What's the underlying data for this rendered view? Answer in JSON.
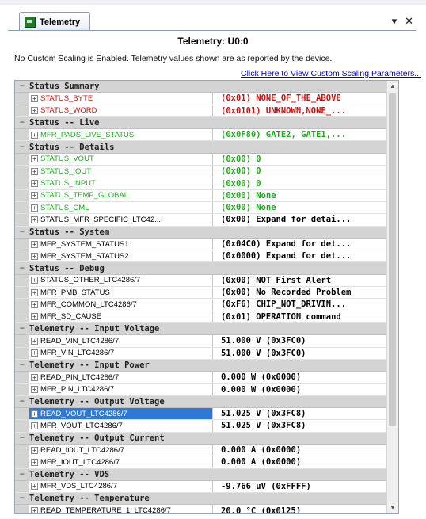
{
  "tab": {
    "label": "Telemetry"
  },
  "controls": {
    "dropdown": "▾",
    "close": "✕"
  },
  "title": "Telemetry: U0:0",
  "info": "No Custom Scaling is Enabled.  Telemetry values shown are as reported by the device.",
  "scaling_link": "Click Here to View Custom Scaling Parameters...",
  "colors": {
    "red": "#cc1111",
    "green": "#22a822",
    "black": "#000000",
    "selection": "#2f78d6"
  },
  "grid_rows": [
    {
      "type": "cat",
      "label": "Status Summary"
    },
    {
      "type": "prop",
      "name": "STATUS_BYTE",
      "value": "(0x01) NONE_OF_THE_ABOVE",
      "color": "red"
    },
    {
      "type": "prop",
      "name": "STATUS_WORD",
      "value": "(0x0101)  UNKNOWN,NONE_...",
      "color": "red"
    },
    {
      "type": "cat",
      "label": "Status -- Live"
    },
    {
      "type": "prop",
      "name": "MFR_PADS_LIVE_STATUS",
      "value": "(0x0F80)  GATE2, GATE1,...",
      "color": "green"
    },
    {
      "type": "cat",
      "label": "Status -- Details"
    },
    {
      "type": "prop",
      "name": "STATUS_VOUT",
      "value": "(0x00) 0",
      "color": "green"
    },
    {
      "type": "prop",
      "name": "STATUS_IOUT",
      "value": "(0x00) 0",
      "color": "green"
    },
    {
      "type": "prop",
      "name": "STATUS_INPUT",
      "value": "(0x00) 0",
      "color": "green"
    },
    {
      "type": "prop",
      "name": "STATUS_TEMP_GLOBAL",
      "value": "(0x00) None",
      "color": "green"
    },
    {
      "type": "prop",
      "name": "STATUS_CML",
      "value": "(0x00) None",
      "color": "green"
    },
    {
      "type": "prop",
      "name": "STATUS_MFR_SPECIFIC_LTC42...",
      "value": "(0x00) Expand for detai...",
      "color": "black"
    },
    {
      "type": "cat",
      "label": "Status -- System"
    },
    {
      "type": "prop",
      "name": "MFR_SYSTEM_STATUS1",
      "value": "(0x04C0) Expand for det...",
      "color": "black"
    },
    {
      "type": "prop",
      "name": "MFR_SYSTEM_STATUS2",
      "value": "(0x0000) Expand for det...",
      "color": "black"
    },
    {
      "type": "cat",
      "label": "Status -- Debug"
    },
    {
      "type": "prop",
      "name": "STATUS_OTHER_LTC4286/7",
      "value": "(0x00) NOT First Alert",
      "color": "black"
    },
    {
      "type": "prop",
      "name": "MFR_PMB_STATUS",
      "value": "(0x00) No Recorded Problem",
      "color": "black"
    },
    {
      "type": "prop",
      "name": "MFR_COMMON_LTC4286/7",
      "value": "(0xF6)  CHIP_NOT_DRIVIN...",
      "color": "black"
    },
    {
      "type": "prop",
      "name": "MFR_SD_CAUSE",
      "value": "(0x01) OPERATION command",
      "color": "black"
    },
    {
      "type": "cat",
      "label": "Telemetry -- Input Voltage"
    },
    {
      "type": "prop",
      "name": "READ_VIN_LTC4286/7",
      "value": "51.000 V (0x3FC0)",
      "color": "black"
    },
    {
      "type": "prop",
      "name": "MFR_VIN_LTC4286/7",
      "value": "51.000 V (0x3FC0)",
      "color": "black"
    },
    {
      "type": "cat",
      "label": "Telemetry -- Input Power"
    },
    {
      "type": "prop",
      "name": "READ_PIN_LTC4286/7",
      "value": "0.000 W (0x0000)",
      "color": "black"
    },
    {
      "type": "prop",
      "name": "MFR_PIN_LTC4286/7",
      "value": "0.000 W (0x0000)",
      "color": "black"
    },
    {
      "type": "cat",
      "label": "Telemetry -- Output Voltage"
    },
    {
      "type": "prop",
      "name": "READ_VOUT_LTC4286/7",
      "value": "51.025 V (0x3FC8)",
      "color": "black",
      "selected": true
    },
    {
      "type": "prop",
      "name": "MFR_VOUT_LTC4286/7",
      "value": "51.025 V (0x3FC8)",
      "color": "black"
    },
    {
      "type": "cat",
      "label": "Telemetry -- Output Current"
    },
    {
      "type": "prop",
      "name": "READ_IOUT_LTC4286/7",
      "value": "0.000 A (0x0000)",
      "color": "black"
    },
    {
      "type": "prop",
      "name": "MFR_IOUT_LTC4286/7",
      "value": "0.000 A (0x0000)",
      "color": "black"
    },
    {
      "type": "cat",
      "label": "Telemetry -- VDS"
    },
    {
      "type": "prop",
      "name": "MFR_VDS_LTC4286/7",
      "value": "-9.766 uV (0xFFFF)",
      "color": "black"
    },
    {
      "type": "cat",
      "label": "Telemetry -- Temperature"
    },
    {
      "type": "prop",
      "name": "READ_TEMPERATURE_1_LTC4286/7",
      "value": "20.0 °C (0x0125)",
      "color": "black"
    }
  ]
}
